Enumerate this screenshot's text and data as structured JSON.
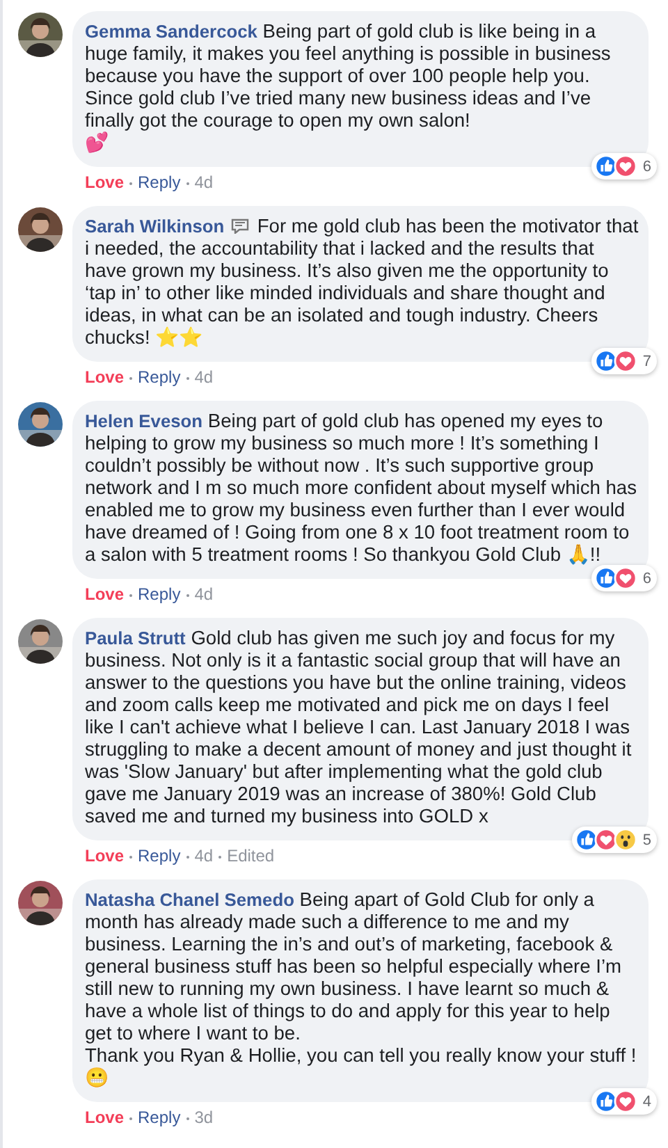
{
  "comments": [
    {
      "author": "Gemma Sandercock",
      "text": "Being part of gold club is like being in a huge family, it makes you feel anything is possible in business because you have the support of over 100 people help you. Since gold club I’ve tried many new business ideas and I’ve finally got the courage to open my own salon!\n💕",
      "reactions": {
        "types": [
          {
            "kind": "like"
          },
          {
            "kind": "love"
          }
        ],
        "count": "6"
      },
      "actions": [
        {
          "label": "Love",
          "selected": true
        },
        {
          "label": "Reply",
          "selected": false
        }
      ],
      "time": "4d"
    },
    {
      "author": "Sarah Wilkinson",
      "badge": true,
      "text": "For me gold club has been the motivator that i needed, the accountability that i lacked and the results that have grown my business. It’s also given me the opportunity to ‘tap in’ to other like minded individuals and share thought and ideas, in what can be an isolated and tough industry. Cheers chucks! ⭐⭐",
      "reactions": {
        "types": [
          {
            "kind": "like"
          },
          {
            "kind": "love"
          }
        ],
        "count": "7"
      },
      "actions": [
        {
          "label": "Love",
          "selected": true
        },
        {
          "label": "Reply",
          "selected": false
        }
      ],
      "time": "4d"
    },
    {
      "author": "Helen Eveson",
      "text": "Being part of gold club has opened my eyes to helping to grow my business so much more ! It’s something I couldn’t possibly be without now . It’s such supportive group network and I m so much more confident about myself which has enabled me to grow my business even further than I ever would have dreamed of ! Going from one 8 x 10 foot treatment room to a salon with 5 treatment rooms ! So thankyou Gold Club 🙏!!",
      "reactions": {
        "types": [
          {
            "kind": "like"
          },
          {
            "kind": "love"
          }
        ],
        "count": "6"
      },
      "actions": [
        {
          "label": "Love",
          "selected": true
        },
        {
          "label": "Reply",
          "selected": false
        }
      ],
      "time": "4d"
    },
    {
      "author": "Paula Strutt",
      "text": "Gold club has given me such joy and focus for my business. Not only is it a fantastic social group that will have an answer to the questions you have but the online training, videos and zoom calls keep me motivated and pick me on days I feel like I can't achieve what I believe I can. Last January 2018 I was struggling to make a decent amount of money and just thought it was 'Slow January' but after implementing what the gold club gave me January 2019 was an increase of 380%! Gold Club saved me and turned my business into GOLD x",
      "reactions": {
        "types": [
          {
            "kind": "like"
          },
          {
            "kind": "love"
          },
          {
            "kind": "wow"
          }
        ],
        "count": "5"
      },
      "actions": [
        {
          "label": "Love",
          "selected": true
        },
        {
          "label": "Reply",
          "selected": false
        }
      ],
      "time": "4d",
      "edited": "Edited"
    },
    {
      "author": "Natasha Chanel Semedo",
      "text": "Being apart of Gold Club for only a month has already made such a difference to me and my business. Learning the in’s and out’s of marketing, facebook & general business stuff has been so helpful especially where I’m still new to running my own business. I have learnt so much & have a whole list of things to do and apply for this year to help get to where I want to be.\nThank you Ryan & Hollie, you can tell you really know your stuff !\n😬",
      "reactions": {
        "types": [
          {
            "kind": "like"
          },
          {
            "kind": "love"
          }
        ],
        "count": "4"
      },
      "actions": [
        {
          "label": "Love",
          "selected": true
        },
        {
          "label": "Reply",
          "selected": false
        }
      ],
      "time": "3d"
    }
  ]
}
